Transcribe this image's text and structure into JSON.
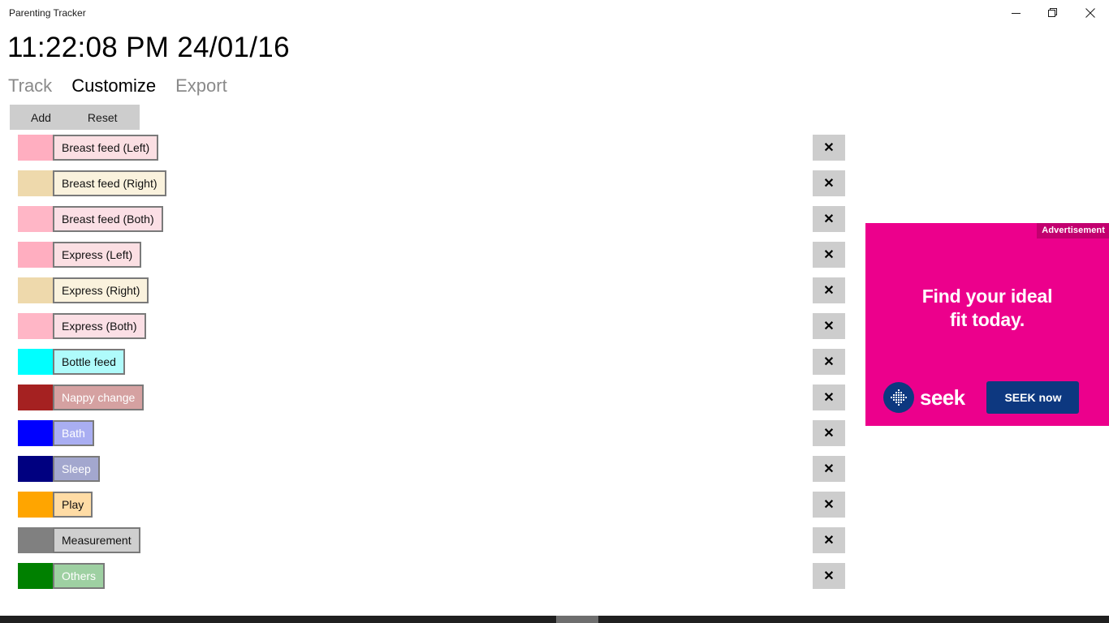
{
  "window": {
    "title": "Parenting Tracker",
    "controls": [
      {
        "name": "minimize",
        "glyph": "minimize-icon"
      },
      {
        "name": "restore",
        "glyph": "restore-icon"
      },
      {
        "name": "close",
        "glyph": "close-icon"
      }
    ]
  },
  "clock": "11:22:08 PM 24/01/16",
  "nav": [
    {
      "label": "Track",
      "active": false
    },
    {
      "label": "Customize",
      "active": true
    },
    {
      "label": "Export",
      "active": false
    }
  ],
  "toolbar": {
    "add_label": "Add",
    "reset_label": "Reset"
  },
  "delete_button_glyph": "✕",
  "categories": [
    {
      "label": "Breast feed (Left)",
      "swatch": "#ffaec0",
      "label_bg": "#fbdfe3",
      "label_fg": "#111111"
    },
    {
      "label": "Breast feed (Right)",
      "swatch": "#eed9ac",
      "label_bg": "#faf2dd",
      "label_fg": "#111111"
    },
    {
      "label": "Breast feed (Both)",
      "swatch": "#ffb6c6",
      "label_bg": "#fbdfe5",
      "label_fg": "#111111"
    },
    {
      "label": "Express (Left)",
      "swatch": "#ffaec0",
      "label_bg": "#fbdfe3",
      "label_fg": "#111111"
    },
    {
      "label": "Express (Right)",
      "swatch": "#eed9ac",
      "label_bg": "#faf2dd",
      "label_fg": "#111111"
    },
    {
      "label": "Express (Both)",
      "swatch": "#ffb6c6",
      "label_bg": "#fbdfe5",
      "label_fg": "#111111"
    },
    {
      "label": "Bottle feed",
      "swatch": "#00ffff",
      "label_bg": "#affbfb",
      "label_fg": "#111111"
    },
    {
      "label": "Nappy change",
      "swatch": "#a52121",
      "label_bg": "#d5a1a1",
      "label_fg": "#ffffff"
    },
    {
      "label": "Bath",
      "swatch": "#0000ff",
      "label_bg": "#a9aef2",
      "label_fg": "#ffffff"
    },
    {
      "label": "Sleep",
      "swatch": "#000080",
      "label_bg": "#a3a7ce",
      "label_fg": "#ffffff"
    },
    {
      "label": "Play",
      "swatch": "#ffa500",
      "label_bg": "#ffdca5",
      "label_fg": "#111111"
    },
    {
      "label": "Measurement",
      "swatch": "#808080",
      "label_bg": "#cfcfcf",
      "label_fg": "#111111"
    },
    {
      "label": "Others",
      "swatch": "#008000",
      "label_bg": "#9ed0a2",
      "label_fg": "#ffffff"
    }
  ],
  "advertisement": {
    "tag": "Advertisement",
    "headline_line1": "Find your ideal",
    "headline_line2": "fit today.",
    "brand": "seek",
    "cta": "SEEK now",
    "bg_color": "#ec008c",
    "brand_color": "#0d3880"
  }
}
